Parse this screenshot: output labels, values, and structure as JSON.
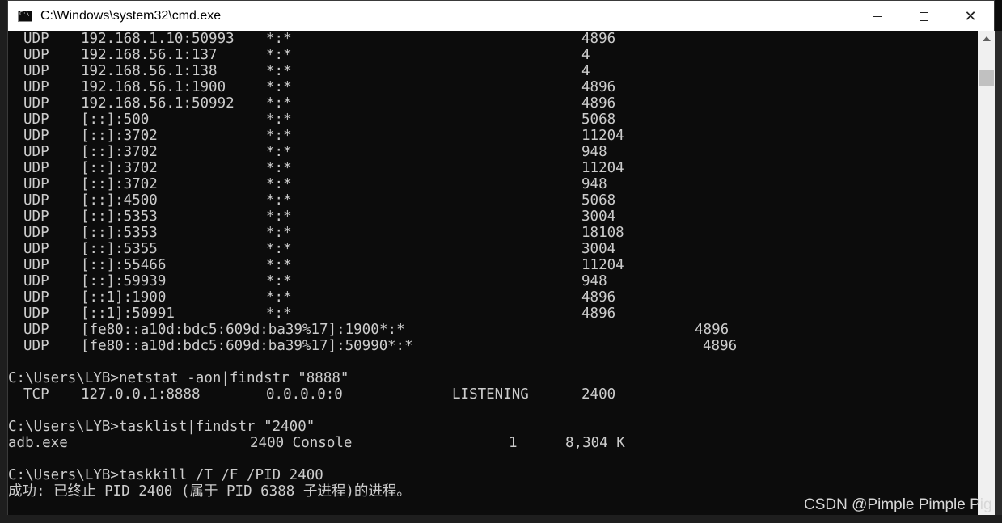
{
  "window": {
    "title": "C:\\Windows\\system32\\cmd.exe"
  },
  "udp_rows": [
    {
      "proto": "UDP",
      "local": "192.168.1.10:50993",
      "foreign": "*:*",
      "pid": "4896"
    },
    {
      "proto": "UDP",
      "local": "192.168.56.1:137",
      "foreign": "*:*",
      "pid": "4"
    },
    {
      "proto": "UDP",
      "local": "192.168.56.1:138",
      "foreign": "*:*",
      "pid": "4"
    },
    {
      "proto": "UDP",
      "local": "192.168.56.1:1900",
      "foreign": "*:*",
      "pid": "4896"
    },
    {
      "proto": "UDP",
      "local": "192.168.56.1:50992",
      "foreign": "*:*",
      "pid": "4896"
    },
    {
      "proto": "UDP",
      "local": "[::]:500",
      "foreign": "*:*",
      "pid": "5068"
    },
    {
      "proto": "UDP",
      "local": "[::]:3702",
      "foreign": "*:*",
      "pid": "11204"
    },
    {
      "proto": "UDP",
      "local": "[::]:3702",
      "foreign": "*:*",
      "pid": "948"
    },
    {
      "proto": "UDP",
      "local": "[::]:3702",
      "foreign": "*:*",
      "pid": "11204"
    },
    {
      "proto": "UDP",
      "local": "[::]:3702",
      "foreign": "*:*",
      "pid": "948"
    },
    {
      "proto": "UDP",
      "local": "[::]:4500",
      "foreign": "*:*",
      "pid": "5068"
    },
    {
      "proto": "UDP",
      "local": "[::]:5353",
      "foreign": "*:*",
      "pid": "3004"
    },
    {
      "proto": "UDP",
      "local": "[::]:5353",
      "foreign": "*:*",
      "pid": "18108"
    },
    {
      "proto": "UDP",
      "local": "[::]:5355",
      "foreign": "*:*",
      "pid": "3004"
    },
    {
      "proto": "UDP",
      "local": "[::]:55466",
      "foreign": "*:*",
      "pid": "11204"
    },
    {
      "proto": "UDP",
      "local": "[::]:59939",
      "foreign": "*:*",
      "pid": "948"
    },
    {
      "proto": "UDP",
      "local": "[::1]:1900",
      "foreign": "*:*",
      "pid": "4896"
    },
    {
      "proto": "UDP",
      "local": "[::1]:50991",
      "foreign": "*:*",
      "pid": "4896"
    }
  ],
  "udp_wide_rows": [
    {
      "proto": "UDP",
      "local": "[fe80::a10d:bdc5:609d:ba39%17]:1900",
      "foreign": "*:*",
      "pid": "4896"
    },
    {
      "proto": "UDP",
      "local": "[fe80::a10d:bdc5:609d:ba39%17]:50990",
      "foreign": "*:*",
      "pid": "4896"
    }
  ],
  "commands": {
    "netstat": "C:\\Users\\LYB>netstat -aon|findstr \"8888\"",
    "tasklist": "C:\\Users\\LYB>tasklist|findstr \"2400\"",
    "taskkill": "C:\\Users\\LYB>taskkill /T /F /PID 2400"
  },
  "netstat_result": {
    "proto": "TCP",
    "local": "127.0.0.1:8888",
    "foreign": "0.0.0.0:0",
    "state": "LISTENING",
    "pid": "2400"
  },
  "tasklist_result": {
    "image": "adb.exe",
    "pid_session": "2400 Console",
    "session_num": "1",
    "mem": "8,304 K"
  },
  "taskkill_result": "成功: 已终止 PID 2400 (属于 PID 6388 子进程)的进程。",
  "watermark": "CSDN @Pimple Pimple Pig",
  "colors": {
    "console_bg": "#0c0c0c",
    "console_text": "#cccccc",
    "titlebar_bg": "#ffffff"
  }
}
